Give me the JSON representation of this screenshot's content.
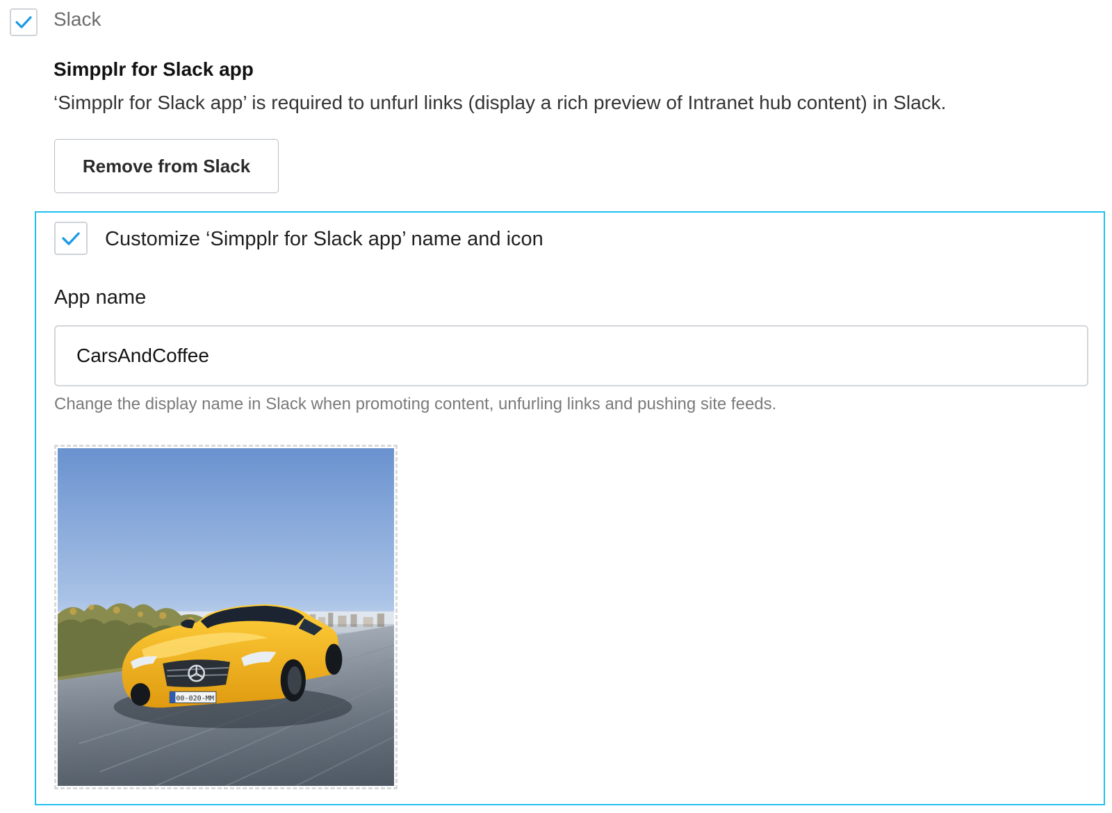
{
  "slack": {
    "label": "Slack",
    "checked": true
  },
  "app_section": {
    "title": "Simpplr for Slack app",
    "description": "‘Simpplr for Slack app’ is required to unfurl links (display a rich preview of Intranet hub content) in Slack.",
    "remove_button_label": "Remove from Slack"
  },
  "customize": {
    "label": "Customize ‘Simpplr for Slack app’ name and icon",
    "checked": true,
    "app_name_label": "App name",
    "app_name_value": "CarsAndCoffee",
    "help_text": "Change the display name in Slack when promoting content, unfurling links and pushing site feeds.",
    "icon_image": {
      "description": "yellow sports car on road",
      "license_plate": "00-020-MM"
    }
  },
  "colors": {
    "accent": "#1ec0ef",
    "checkmark": "#1a9be6",
    "border": "#cfd3d8"
  },
  "icons": {
    "checkbox_checked": "check-icon"
  }
}
